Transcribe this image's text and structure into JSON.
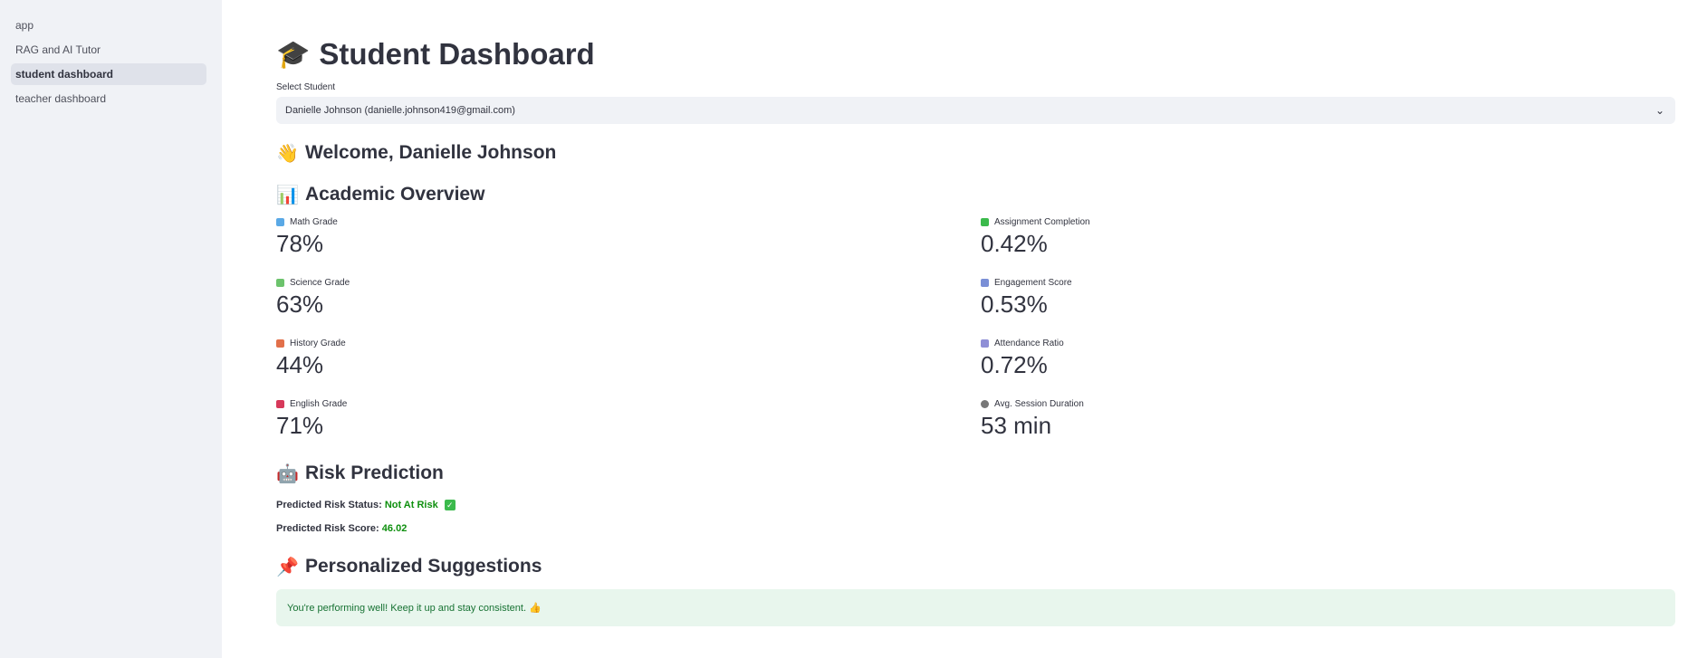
{
  "sidebar": {
    "items": [
      {
        "label": "app"
      },
      {
        "label": "RAG and AI Tutor"
      },
      {
        "label": "student dashboard"
      },
      {
        "label": "teacher dashboard"
      }
    ]
  },
  "page": {
    "title": "Student Dashboard",
    "title_icon": "graduation-cap-icon"
  },
  "student_select": {
    "label": "Select Student",
    "value": "Danielle Johnson (danielle.johnson419@gmail.com)"
  },
  "welcome": {
    "text": "Welcome, Danielle Johnson",
    "icon": "waving-hand-icon"
  },
  "academic_overview": {
    "title": "Academic Overview",
    "icon": "bar-chart-icon",
    "metrics_left": [
      {
        "label": "Math Grade",
        "value": "78%",
        "color": "#5aa9e6"
      },
      {
        "label": "Science Grade",
        "value": "63%",
        "color": "#6cc36c"
      },
      {
        "label": "History Grade",
        "value": "44%",
        "color": "#e2704a"
      },
      {
        "label": "English Grade",
        "value": "71%",
        "color": "#d7395a"
      }
    ],
    "metrics_right": [
      {
        "label": "Assignment Completion",
        "value": "0.42%",
        "color": "#3bba4c"
      },
      {
        "label": "Engagement Score",
        "value": "0.53%",
        "color": "#7a8fd6"
      },
      {
        "label": "Attendance Ratio",
        "value": "0.72%",
        "color": "#8f8fd6"
      },
      {
        "label": "Avg. Session Duration",
        "value": "53 min",
        "color": "#777777"
      }
    ]
  },
  "risk": {
    "title": "Risk Prediction",
    "icon": "robot-icon",
    "status_label": "Predicted Risk Status:",
    "status_value": "Not At Risk",
    "score_label": "Predicted Risk Score:",
    "score_value": "46.02",
    "accent": "#0d8f0d"
  },
  "suggestions": {
    "title": "Personalized Suggestions",
    "icon": "pushpin-icon",
    "message": "You're performing well! Keep it up and stay consistent. 👍"
  }
}
